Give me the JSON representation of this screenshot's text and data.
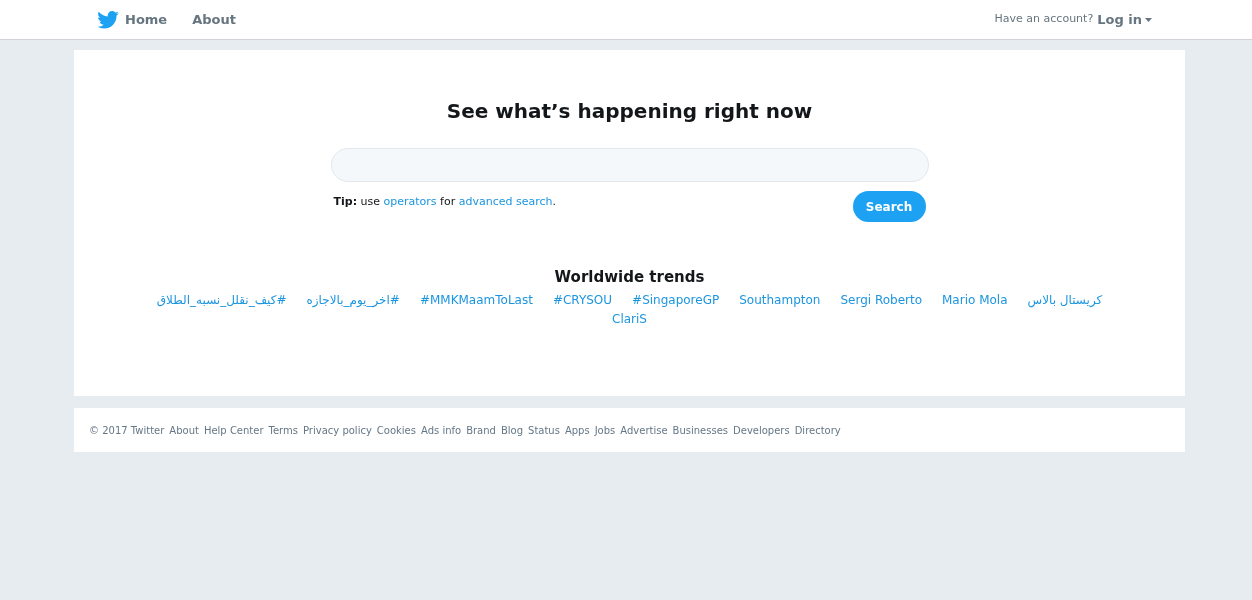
{
  "nav": {
    "items": [
      "Home",
      "About"
    ],
    "account_prompt": "Have an account?",
    "login": "Log in"
  },
  "search": {
    "heading": "See what’s happening right now",
    "button": "Search",
    "tip": {
      "before": "**Tip:** use",
      "link_1": "operators",
      "middle": "for",
      "link_2": "advanced search",
      "after": "."
    }
  },
  "trends": {
    "title": "Worldwide trends",
    "items": [
      "#كيف_نقلل_نسبه_الطلاق",
      "#اخر_يوم_بالاجازه",
      "#MMKMaamToLast",
      "#CRYSOU",
      "#SingaporeGP",
      "Southampton",
      "Sergi Roberto",
      "Mario Mola",
      "كريستال بالاس",
      "ClariS"
    ]
  },
  "footer": [
    "© 2017 Twitter",
    "About",
    "Help Center",
    "Terms",
    "Privacy policy",
    "Cookies",
    "Ads info",
    "Brand",
    "Blog",
    "Status",
    "Apps",
    "Jobs",
    "Advertise",
    "Businesses",
    "Developers",
    "Directory"
  ]
}
